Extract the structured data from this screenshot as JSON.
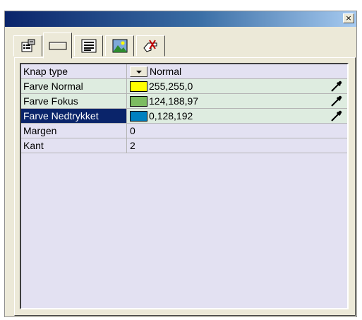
{
  "window": {
    "close_glyph": "×"
  },
  "tabs": [
    {
      "icon": "properties-icon",
      "active": false
    },
    {
      "icon": "button-icon",
      "active": true
    },
    {
      "icon": "text-align-icon",
      "active": false
    },
    {
      "icon": "image-icon",
      "active": false
    },
    {
      "icon": "hand-action-icon",
      "active": false
    }
  ],
  "properties": {
    "rows": [
      {
        "label": "Knap type",
        "value": "Normal"
      },
      {
        "label": "Farve Normal",
        "value": "255,255,0",
        "swatch": "#ffff00"
      },
      {
        "label": "Farve Fokus",
        "value": "124,188,97",
        "swatch": "#7cbc61"
      },
      {
        "label": "Farve Nedtrykket",
        "value": "0,128,192",
        "swatch": "#0080c0"
      },
      {
        "label": "Margen",
        "value": "0"
      },
      {
        "label": "Kant",
        "value": "2"
      }
    ]
  },
  "colors": {
    "selection": "#0a246a",
    "color_row_bg": "#deece0",
    "grid_bg": "#e3e1f2"
  }
}
